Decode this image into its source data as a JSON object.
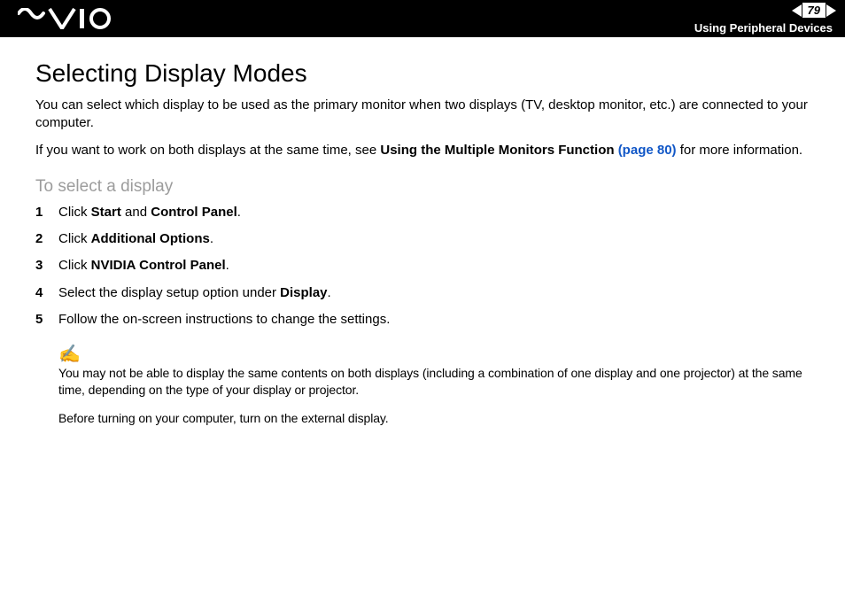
{
  "header": {
    "page_number": "79",
    "section": "Using Peripheral Devices"
  },
  "title": "Selecting Display Modes",
  "intro_p1": "You can select which display to be used as the primary monitor when two displays (TV, desktop monitor, etc.) are connected to your computer.",
  "intro_p2_a": "If you want to work on both displays at the same time, see ",
  "intro_p2_bold": "Using the Multiple Monitors Function ",
  "intro_p2_link": "(page 80)",
  "intro_p2_b": " for more information.",
  "subtitle": "To select a display",
  "steps": [
    {
      "n": "1",
      "pre": "Click ",
      "b1": "Start",
      "mid": " and ",
      "b2": "Control Panel",
      "post": "."
    },
    {
      "n": "2",
      "pre": "Click ",
      "b1": "Additional Options",
      "mid": "",
      "b2": "",
      "post": "."
    },
    {
      "n": "3",
      "pre": "Click ",
      "b1": "NVIDIA Control Panel",
      "mid": "",
      "b2": "",
      "post": "."
    },
    {
      "n": "4",
      "pre": "Select the display setup option under ",
      "b1": "Display",
      "mid": "",
      "b2": "",
      "post": "."
    },
    {
      "n": "5",
      "pre": "Follow the on-screen instructions to change the settings.",
      "b1": "",
      "mid": "",
      "b2": "",
      "post": ""
    }
  ],
  "note1": "You may not be able to display the same contents on both displays (including a combination of one display and one projector) at the same time, depending on the type of your display or projector.",
  "note2": "Before turning on your computer, turn on the external display."
}
